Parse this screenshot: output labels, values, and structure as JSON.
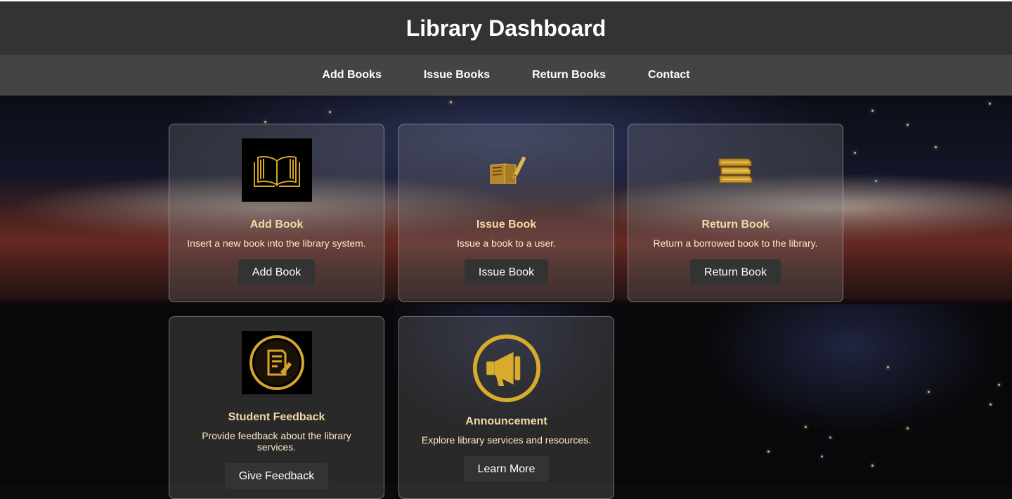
{
  "header": {
    "title": "Library Dashboard"
  },
  "nav": {
    "items": [
      {
        "label": "Add Books"
      },
      {
        "label": "Issue Books"
      },
      {
        "label": "Return Books"
      },
      {
        "label": "Contact"
      }
    ]
  },
  "cards": [
    {
      "icon": "open-book-icon",
      "title": "Add Book",
      "description": "Insert a new book into the library system.",
      "button": "Add Book"
    },
    {
      "icon": "book-pen-icon",
      "title": "Issue Book",
      "description": "Issue a book to a user.",
      "button": "Issue Book"
    },
    {
      "icon": "book-stack-icon",
      "title": "Return Book",
      "description": "Return a borrowed book to the library.",
      "button": "Return Book"
    },
    {
      "icon": "feedback-document-icon",
      "title": "Student Feedback",
      "description": "Provide feedback about the library services.",
      "button": "Give Feedback"
    },
    {
      "icon": "megaphone-icon",
      "title": "Announcement",
      "description": "Explore library services and resources.",
      "button": "Learn More"
    }
  ],
  "colors": {
    "header_bg": "#333333",
    "nav_bg": "#444444",
    "card_title": "#f3d9a6",
    "icon_gold": "#d4a52a",
    "button_bg": "#333333"
  }
}
